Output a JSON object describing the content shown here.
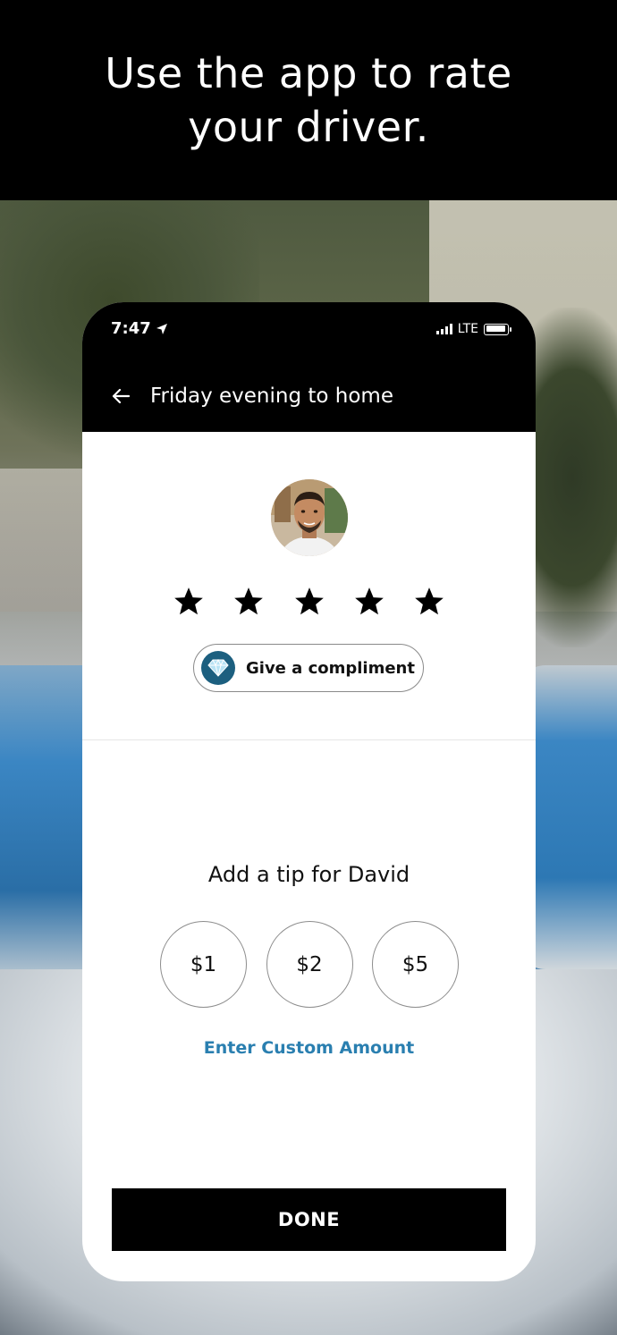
{
  "headline": {
    "line1": "Use the app to rate",
    "line2": "your driver."
  },
  "status_bar": {
    "time": "7:47",
    "network": "LTE",
    "location_icon": "location-arrow-icon",
    "signal_icon": "signal-bars-icon",
    "battery_icon": "battery-icon"
  },
  "nav": {
    "back_icon": "back-arrow-icon",
    "title": "Friday evening to home"
  },
  "rating": {
    "driver_avatar_icon": "driver-avatar",
    "stars_total": 5,
    "star_icon": "star-icon"
  },
  "compliment": {
    "icon": "diamond-icon",
    "label": "Give a compliment"
  },
  "tip": {
    "title": "Add a tip for David",
    "options": [
      "$1",
      "$2",
      "$5"
    ],
    "custom_label": "Enter Custom Amount"
  },
  "done_label": "DONE",
  "colors": {
    "accent_link": "#2a7fb0",
    "badge_bg": "#1c5f7f",
    "primary_button": "#000000"
  }
}
